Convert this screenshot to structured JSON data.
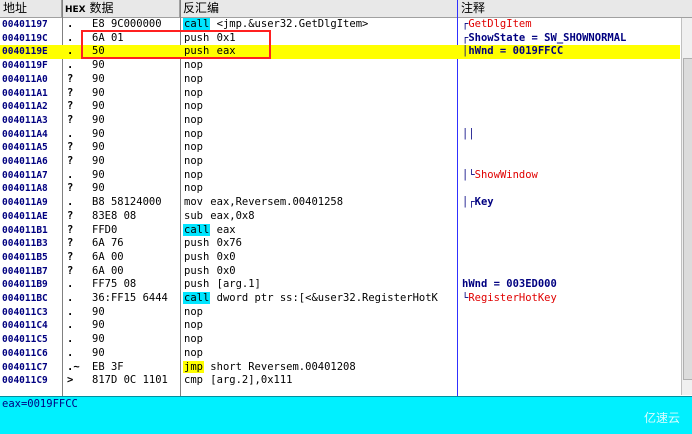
{
  "columns": {
    "addr": "地址",
    "hex_abbr": "HEX",
    "hex": "数据",
    "disasm": "反汇编",
    "comment": "注释"
  },
  "rows": [
    {
      "addr": "00401197",
      "mark": ".",
      "hex": "E8 9C000000",
      "mn": "call",
      "mnstyle": "call",
      "ops": "<jmp.&user32.GetDlgItem>",
      "bracket": "",
      "cmt": "GetDlgItem",
      "cmtstyle": "red",
      "prefix": "┌"
    },
    {
      "addr": "0040119C",
      "mark": ".",
      "hex": "6A 01",
      "mn": "push",
      "mnstyle": "",
      "ops": "0x1",
      "bracket": "",
      "cmt": "ShowState = SW_SHOWNORMAL",
      "cmtstyle": "blue",
      "prefix": "┌"
    },
    {
      "addr": "0040119E",
      "mark": ".",
      "hex": "50",
      "mn": "push",
      "mnstyle": "",
      "ops": "eax",
      "bracket": "",
      "cmt": "hWnd = 0019FFCC",
      "cmtstyle": "blue",
      "prefix": "│",
      "highlight": true
    },
    {
      "addr": "0040119F",
      "mark": ".",
      "hex": "90",
      "mn": "nop",
      "mnstyle": "",
      "ops": "",
      "cmt": "",
      "cmtstyle": "",
      "prefix": ""
    },
    {
      "addr": "004011A0",
      "mark": "?",
      "hex": "90",
      "mn": "nop",
      "mnstyle": "",
      "ops": "",
      "cmt": "",
      "cmtstyle": "",
      "prefix": ""
    },
    {
      "addr": "004011A1",
      "mark": "?",
      "hex": "90",
      "mn": "nop",
      "mnstyle": "",
      "ops": "",
      "cmt": "",
      "cmtstyle": "",
      "prefix": ""
    },
    {
      "addr": "004011A2",
      "mark": "?",
      "hex": "90",
      "mn": "nop",
      "mnstyle": "",
      "ops": "",
      "cmt": "",
      "cmtstyle": "",
      "prefix": ""
    },
    {
      "addr": "004011A3",
      "mark": "?",
      "hex": "90",
      "mn": "nop",
      "mnstyle": "",
      "ops": "",
      "cmt": "",
      "cmtstyle": "",
      "prefix": ""
    },
    {
      "addr": "004011A4",
      "mark": ".",
      "hex": "90",
      "mn": "nop",
      "mnstyle": "",
      "ops": "",
      "cmt": "││",
      "cmtstyle": "blue",
      "prefix": ""
    },
    {
      "addr": "004011A5",
      "mark": "?",
      "hex": "90",
      "mn": "nop",
      "mnstyle": "",
      "ops": "",
      "cmt": "",
      "cmtstyle": "",
      "prefix": ""
    },
    {
      "addr": "004011A6",
      "mark": "?",
      "hex": "90",
      "mn": "nop",
      "mnstyle": "",
      "ops": "",
      "cmt": "",
      "cmtstyle": "",
      "prefix": ""
    },
    {
      "addr": "004011A7",
      "mark": ".",
      "hex": "90",
      "mn": "nop",
      "mnstyle": "",
      "ops": "",
      "cmt": "ShowWindow",
      "cmtstyle": "red",
      "prefix": "│└"
    },
    {
      "addr": "004011A8",
      "mark": "?",
      "hex": "90",
      "mn": "nop",
      "mnstyle": "",
      "ops": "",
      "cmt": "",
      "cmtstyle": "",
      "prefix": ""
    },
    {
      "addr": "004011A9",
      "mark": ".",
      "hex": "B8 58124000",
      "mn": "mov",
      "mnstyle": "",
      "ops": "eax,Reversem.00401258",
      "cmt": "Key",
      "cmtstyle": "blue",
      "prefix": "│┌"
    },
    {
      "addr": "004011AE",
      "mark": "?",
      "hex": "83E8 08",
      "mn": "sub",
      "mnstyle": "",
      "ops": "eax,0x8",
      "cmt": "",
      "cmtstyle": "",
      "prefix": ""
    },
    {
      "addr": "004011B1",
      "mark": "?",
      "hex": "FFD0",
      "mn": "call",
      "mnstyle": "call",
      "ops": "eax",
      "cmt": "",
      "cmtstyle": "",
      "prefix": ""
    },
    {
      "addr": "004011B3",
      "mark": "?",
      "hex": "6A 76",
      "mn": "push",
      "mnstyle": "",
      "ops": "0x76",
      "cmt": "",
      "cmtstyle": "",
      "prefix": ""
    },
    {
      "addr": "004011B5",
      "mark": "?",
      "hex": "6A 00",
      "mn": "push",
      "mnstyle": "",
      "ops": "0x0",
      "cmt": "",
      "cmtstyle": "",
      "prefix": ""
    },
    {
      "addr": "004011B7",
      "mark": "?",
      "hex": "6A 00",
      "mn": "push",
      "mnstyle": "",
      "ops": "0x0",
      "cmt": "",
      "cmtstyle": "",
      "prefix": ""
    },
    {
      "addr": "004011B9",
      "mark": ".",
      "hex": "FF75 08",
      "mn": "push",
      "mnstyle": "",
      "ops": "[arg.1]",
      "cmt": "hWnd = 003ED000",
      "cmtstyle": "blue",
      "prefix": ""
    },
    {
      "addr": "004011BC",
      "mark": ".",
      "hex": "36:FF15 6444",
      "mn": "call",
      "mnstyle": "call",
      "ops": "dword ptr ss:[<&user32.RegisterHotK",
      "cmt": "RegisterHotKey",
      "cmtstyle": "red",
      "prefix": "└"
    },
    {
      "addr": "004011C3",
      "mark": ".",
      "hex": "90",
      "mn": "nop",
      "mnstyle": "",
      "ops": "",
      "cmt": "",
      "cmtstyle": "",
      "prefix": ""
    },
    {
      "addr": "004011C4",
      "mark": ".",
      "hex": "90",
      "mn": "nop",
      "mnstyle": "",
      "ops": "",
      "cmt": "",
      "cmtstyle": "",
      "prefix": ""
    },
    {
      "addr": "004011C5",
      "mark": ".",
      "hex": "90",
      "mn": "nop",
      "mnstyle": "",
      "ops": "",
      "cmt": "",
      "cmtstyle": "",
      "prefix": ""
    },
    {
      "addr": "004011C6",
      "mark": ".",
      "hex": "90",
      "mn": "nop",
      "mnstyle": "",
      "ops": "",
      "cmt": "",
      "cmtstyle": "",
      "prefix": ""
    },
    {
      "addr": "004011C7",
      "mark": ".~",
      "hex": "EB 3F",
      "mn": "jmp",
      "mnstyle": "jmp",
      "ops": "short Reversem.00401208",
      "cmt": "",
      "cmtstyle": "",
      "prefix": ""
    },
    {
      "addr": "004011C9",
      "mark": ">",
      "hex": "817D 0C 1101",
      "mn": "cmp",
      "mnstyle": "",
      "ops": "[arg.2],0x111",
      "cmt": "",
      "cmtstyle": "",
      "prefix": ""
    }
  ],
  "status": {
    "text": "eax=0019FFCC"
  },
  "watermark": "亿速云",
  "colors": {
    "highlight": "#ffff00",
    "call": "#00e5ff",
    "status_bg": "#00f0ff",
    "comment_red": "#e00000",
    "address": "#000080"
  }
}
